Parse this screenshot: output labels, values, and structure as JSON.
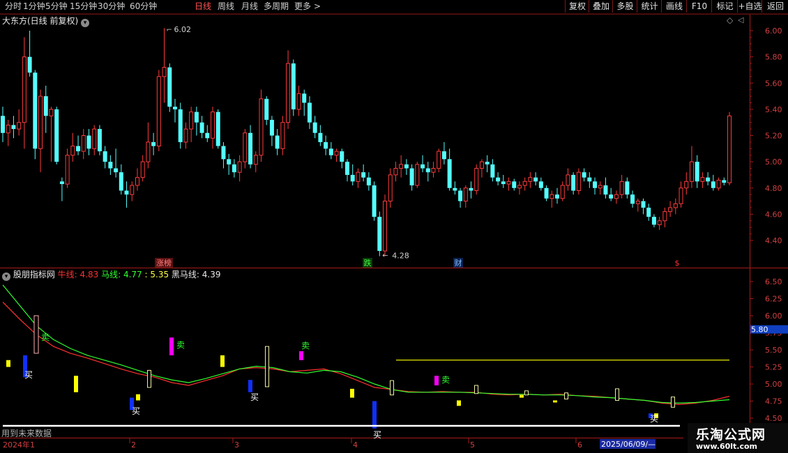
{
  "toolbar": {
    "periods": [
      {
        "label": "分时"
      },
      {
        "label": "1分钟"
      },
      {
        "label": "5分钟"
      },
      {
        "label": "15分钟"
      },
      {
        "label": "30分钟"
      },
      {
        "label": "60分钟"
      },
      {
        "label": "日线",
        "active": true
      },
      {
        "label": "周线"
      },
      {
        "label": "月线"
      },
      {
        "label": "多周期"
      },
      {
        "label": "更多"
      }
    ],
    "more_arrow": ">",
    "buttons": [
      "复权",
      "叠加",
      "多股",
      "统计",
      "画线",
      "F10",
      "标记",
      "+自选",
      "返回"
    ]
  },
  "main_panel": {
    "title": "大东方(日线 前复权)",
    "dropdown_icon": "chevron-down-icon",
    "y_ticks": [
      "6.00",
      "5.80",
      "5.60",
      "5.40",
      "5.20",
      "5.00",
      "4.80",
      "4.60",
      "4.40"
    ],
    "high_label": "6.02",
    "low_label": "4.28",
    "markers": [
      {
        "text": "涨榜",
        "color": "#ff8080",
        "bg": "#5a1010"
      },
      {
        "text": "跌",
        "color": "#40ff40",
        "bg": "#0a3a0a"
      },
      {
        "text": "财",
        "color": "#80c0ff",
        "bg": "#0a2050"
      },
      {
        "text": "$",
        "color": "#ff3030",
        "bg": "#000000"
      }
    ]
  },
  "indicator_panel": {
    "name": "股朋指标网",
    "niu_label": "牛线:",
    "niu_value": "4.83",
    "ma_label": "马线:",
    "ma_value": "4.77",
    "third_value": ": 5.35",
    "hei_label": "黑马线:",
    "hei_value": "4.39",
    "y_ticks": [
      "6.50",
      "6.25",
      "6.00",
      "5.75",
      "5.50",
      "5.25",
      "5.00",
      "4.75",
      "4.50"
    ],
    "current_value": "5.80",
    "buy_label": "买",
    "sell_label": "卖",
    "future_data_text": "用到未来数据"
  },
  "x_axis": {
    "start_label": "2024年1",
    "months": [
      "2",
      "3",
      "4",
      "5",
      "6"
    ],
    "cursor_date": "2025/06/09/—"
  },
  "watermark": {
    "title": "乐淘公式网",
    "url": "www.60lt.com"
  },
  "colors": {
    "up": "#ff3c3c",
    "down": "#54ffff",
    "niu_line": "#ff3030",
    "ma_line": "#30ff30",
    "yellow_line": "#ffff00",
    "magenta": "#ff00ff",
    "blue": "#1030ff",
    "yellow": "#ffff00",
    "grid_border": "#aa1a1a"
  },
  "chart_data": [
    {
      "type": "candlestick",
      "title": "大东方(日线 前复权)",
      "ylim": [
        4.22,
        6.1
      ],
      "y_ticks": [
        6.0,
        5.8,
        5.6,
        5.4,
        5.2,
        5.0,
        4.8,
        4.6,
        4.4
      ],
      "ohlc": [
        [
          5.35,
          5.42,
          5.15,
          5.22
        ],
        [
          5.22,
          5.32,
          5.12,
          5.28
        ],
        [
          5.28,
          5.35,
          5.18,
          5.25
        ],
        [
          5.25,
          5.4,
          5.2,
          5.3
        ],
        [
          5.3,
          5.95,
          5.1,
          5.8
        ],
        [
          5.8,
          6.0,
          5.65,
          5.68
        ],
        [
          5.68,
          5.7,
          5.02,
          5.1
        ],
        [
          5.1,
          5.55,
          4.92,
          5.5
        ],
        [
          5.5,
          5.58,
          5.22,
          5.35
        ],
        [
          5.35,
          5.42,
          5.0,
          5.4
        ],
        [
          5.4,
          5.42,
          4.98,
          5.0
        ],
        [
          4.85,
          4.88,
          4.7,
          4.83
        ],
        [
          4.83,
          5.1,
          4.8,
          5.05
        ],
        [
          5.05,
          5.22,
          5.0,
          5.12
        ],
        [
          5.12,
          5.2,
          5.05,
          5.08
        ],
        [
          5.08,
          5.25,
          5.02,
          5.2
        ],
        [
          5.2,
          5.25,
          5.05,
          5.1
        ],
        [
          5.1,
          5.28,
          5.05,
          5.25
        ],
        [
          5.25,
          5.28,
          5.05,
          5.08
        ],
        [
          5.08,
          5.12,
          4.95,
          5.0
        ],
        [
          5.0,
          5.05,
          4.9,
          4.95
        ],
        [
          4.95,
          5.1,
          4.88,
          4.92
        ],
        [
          4.92,
          4.98,
          4.75,
          4.78
        ],
        [
          4.78,
          4.85,
          4.65,
          4.75
        ],
        [
          4.75,
          4.85,
          4.7,
          4.82
        ],
        [
          4.82,
          4.95,
          4.78,
          4.88
        ],
        [
          4.88,
          5.05,
          4.85,
          5.0
        ],
        [
          5.0,
          5.3,
          4.95,
          5.15
        ],
        [
          5.15,
          5.22,
          5.05,
          5.12
        ],
        [
          5.12,
          5.7,
          5.08,
          5.65
        ],
        [
          5.65,
          6.02,
          5.45,
          5.72
        ],
        [
          5.72,
          5.75,
          5.38,
          5.42
        ],
        [
          5.42,
          5.48,
          5.3,
          5.4
        ],
        [
          5.4,
          5.45,
          5.1,
          5.15
        ],
        [
          5.15,
          5.3,
          5.1,
          5.25
        ],
        [
          5.25,
          5.42,
          5.15,
          5.38
        ],
        [
          5.38,
          5.42,
          5.2,
          5.3
        ],
        [
          5.3,
          5.35,
          5.18,
          5.22
        ],
        [
          5.22,
          5.28,
          5.15,
          5.18
        ],
        [
          5.18,
          5.42,
          5.1,
          5.38
        ],
        [
          5.38,
          5.4,
          5.1,
          5.12
        ],
        [
          5.12,
          5.15,
          4.95,
          5.02
        ],
        [
          5.02,
          5.06,
          4.9,
          4.98
        ],
        [
          4.98,
          5.02,
          4.88,
          4.92
        ],
        [
          4.92,
          5.05,
          4.85,
          5.0
        ],
        [
          5.0,
          5.25,
          4.95,
          5.22
        ],
        [
          5.22,
          5.28,
          4.95,
          4.98
        ],
        [
          4.98,
          5.08,
          4.92,
          5.05
        ],
        [
          5.05,
          5.55,
          5.0,
          5.48
        ],
        [
          5.48,
          5.5,
          5.28,
          5.32
        ],
        [
          5.32,
          5.35,
          5.12,
          5.2
        ],
        [
          5.2,
          5.25,
          5.05,
          5.1
        ],
        [
          5.1,
          5.35,
          5.05,
          5.3
        ],
        [
          5.3,
          5.85,
          5.25,
          5.75
        ],
        [
          5.75,
          5.78,
          5.35,
          5.4
        ],
        [
          5.4,
          5.58,
          5.35,
          5.52
        ],
        [
          5.52,
          5.55,
          5.35,
          5.45
        ],
        [
          5.45,
          5.5,
          5.25,
          5.3
        ],
        [
          5.3,
          5.35,
          5.18,
          5.22
        ],
        [
          5.22,
          5.28,
          5.12,
          5.15
        ],
        [
          5.15,
          5.2,
          5.05,
          5.1
        ],
        [
          5.1,
          5.15,
          5.02,
          5.05
        ],
        [
          5.05,
          5.1,
          5.0,
          5.08
        ],
        [
          5.08,
          5.1,
          4.95,
          5.0
        ],
        [
          5.0,
          5.02,
          4.85,
          4.9
        ],
        [
          4.9,
          4.98,
          4.82,
          4.85
        ],
        [
          4.85,
          4.95,
          4.8,
          4.92
        ],
        [
          4.92,
          4.98,
          4.85,
          4.88
        ],
        [
          4.88,
          4.92,
          4.78,
          4.82
        ],
        [
          4.82,
          4.85,
          4.55,
          4.58
        ],
        [
          4.58,
          4.62,
          4.28,
          4.32
        ],
        [
          4.32,
          4.75,
          4.28,
          4.7
        ],
        [
          4.7,
          4.95,
          4.65,
          4.9
        ],
        [
          4.9,
          5.0,
          4.85,
          4.95
        ],
        [
          4.95,
          5.05,
          4.88,
          4.98
        ],
        [
          4.98,
          5.02,
          4.9,
          4.95
        ],
        [
          4.95,
          4.98,
          4.78,
          4.82
        ],
        [
          4.82,
          5.0,
          4.8,
          4.98
        ],
        [
          4.98,
          5.05,
          4.92,
          4.95
        ],
        [
          4.95,
          5.0,
          4.85,
          4.92
        ],
        [
          4.92,
          5.0,
          4.88,
          4.95
        ],
        [
          4.95,
          5.1,
          4.92,
          5.08
        ],
        [
          5.08,
          5.15,
          4.98,
          5.02
        ],
        [
          5.02,
          5.1,
          4.78,
          4.8
        ],
        [
          4.8,
          4.85,
          4.75,
          4.78
        ],
        [
          4.78,
          4.8,
          4.65,
          4.7
        ],
        [
          4.7,
          4.82,
          4.65,
          4.8
        ],
        [
          4.8,
          4.85,
          4.72,
          4.78
        ],
        [
          4.78,
          4.98,
          4.75,
          4.95
        ],
        [
          4.95,
          5.02,
          4.88,
          5.0
        ],
        [
          5.0,
          5.05,
          4.92,
          4.98
        ],
        [
          4.98,
          5.02,
          4.85,
          4.88
        ],
        [
          4.88,
          4.92,
          4.82,
          4.85
        ],
        [
          4.85,
          4.9,
          4.8,
          4.83
        ],
        [
          4.83,
          4.88,
          4.78,
          4.85
        ],
        [
          4.85,
          4.87,
          4.78,
          4.8
        ],
        [
          4.8,
          4.85,
          4.75,
          4.82
        ],
        [
          4.82,
          4.88,
          4.78,
          4.85
        ],
        [
          4.85,
          4.92,
          4.8,
          4.88
        ],
        [
          4.88,
          4.92,
          4.82,
          4.85
        ],
        [
          4.85,
          4.88,
          4.78,
          4.8
        ],
        [
          4.8,
          4.82,
          4.7,
          4.72
        ],
        [
          4.72,
          4.78,
          4.65,
          4.75
        ],
        [
          4.75,
          4.8,
          4.68,
          4.72
        ],
        [
          4.72,
          4.85,
          4.7,
          4.82
        ],
        [
          4.82,
          4.95,
          4.78,
          4.9
        ],
        [
          4.9,
          4.92,
          4.75,
          4.78
        ],
        [
          4.78,
          4.95,
          4.75,
          4.92
        ],
        [
          4.92,
          4.95,
          4.85,
          4.88
        ],
        [
          4.88,
          4.92,
          4.8,
          4.85
        ],
        [
          4.85,
          4.88,
          4.75,
          4.8
        ],
        [
          4.8,
          4.85,
          4.75,
          4.82
        ],
        [
          4.82,
          4.88,
          4.72,
          4.75
        ],
        [
          4.75,
          4.8,
          4.7,
          4.72
        ],
        [
          4.72,
          4.78,
          4.68,
          4.75
        ],
        [
          4.75,
          4.9,
          4.72,
          4.85
        ],
        [
          4.85,
          4.88,
          4.72,
          4.75
        ],
        [
          4.75,
          4.78,
          4.65,
          4.68
        ],
        [
          4.68,
          4.72,
          4.62,
          4.7
        ],
        [
          4.7,
          4.72,
          4.6,
          4.65
        ],
        [
          4.65,
          4.68,
          4.55,
          4.58
        ],
        [
          4.58,
          4.6,
          4.5,
          4.52
        ],
        [
          4.52,
          4.58,
          4.48,
          4.55
        ],
        [
          4.55,
          4.65,
          4.5,
          4.62
        ],
        [
          4.62,
          4.7,
          4.58,
          4.65
        ],
        [
          4.65,
          4.72,
          4.6,
          4.68
        ],
        [
          4.68,
          4.85,
          4.65,
          4.8
        ],
        [
          4.8,
          4.92,
          4.75,
          4.85
        ],
        [
          4.85,
          5.12,
          4.8,
          5.0
        ],
        [
          5.0,
          5.05,
          4.8,
          4.85
        ],
        [
          4.85,
          4.92,
          4.8,
          4.88
        ],
        [
          4.88,
          4.92,
          4.82,
          4.85
        ],
        [
          4.85,
          4.9,
          4.78,
          4.8
        ],
        [
          4.8,
          4.88,
          4.78,
          4.86
        ],
        [
          4.86,
          4.88,
          4.82,
          4.84
        ],
        [
          4.84,
          5.38,
          4.82,
          5.35
        ]
      ]
    },
    {
      "type": "line",
      "title": "股朋指标网",
      "ylim": [
        4.5,
        6.62
      ],
      "y_ticks": [
        6.5,
        6.25,
        6.0,
        5.75,
        5.5,
        5.25,
        5.0,
        4.75,
        4.5
      ],
      "series": [
        {
          "name": "牛线",
          "values": [
            6.2,
            5.95,
            5.72,
            5.55,
            5.45,
            5.38,
            5.3,
            5.22,
            5.15,
            5.1,
            5.02,
            4.98,
            5.05,
            5.12,
            5.22,
            5.24,
            5.22,
            5.18,
            5.2,
            5.22,
            5.15,
            5.05,
            4.95,
            4.92,
            4.89,
            4.88,
            4.89,
            4.88,
            4.88,
            4.85,
            4.84,
            4.85,
            4.84,
            4.85,
            4.83,
            4.82,
            4.8,
            4.78,
            4.76,
            4.72,
            4.7,
            4.72,
            4.76,
            4.82
          ]
        },
        {
          "name": "马线",
          "values": [
            6.45,
            6.15,
            5.85,
            5.65,
            5.52,
            5.42,
            5.35,
            5.28,
            5.2,
            5.12,
            5.06,
            5.02,
            5.08,
            5.15,
            5.22,
            5.26,
            5.24,
            5.18,
            5.16,
            5.2,
            5.18,
            5.1,
            5.0,
            4.92,
            4.88,
            4.88,
            4.88,
            4.88,
            4.87,
            4.86,
            4.85,
            4.85,
            4.84,
            4.84,
            4.83,
            4.81,
            4.8,
            4.78,
            4.76,
            4.73,
            4.72,
            4.73,
            4.75,
            4.77
          ]
        },
        {
          "name": "",
          "values": [
            5.35,
            5.35
          ]
        }
      ]
    }
  ]
}
